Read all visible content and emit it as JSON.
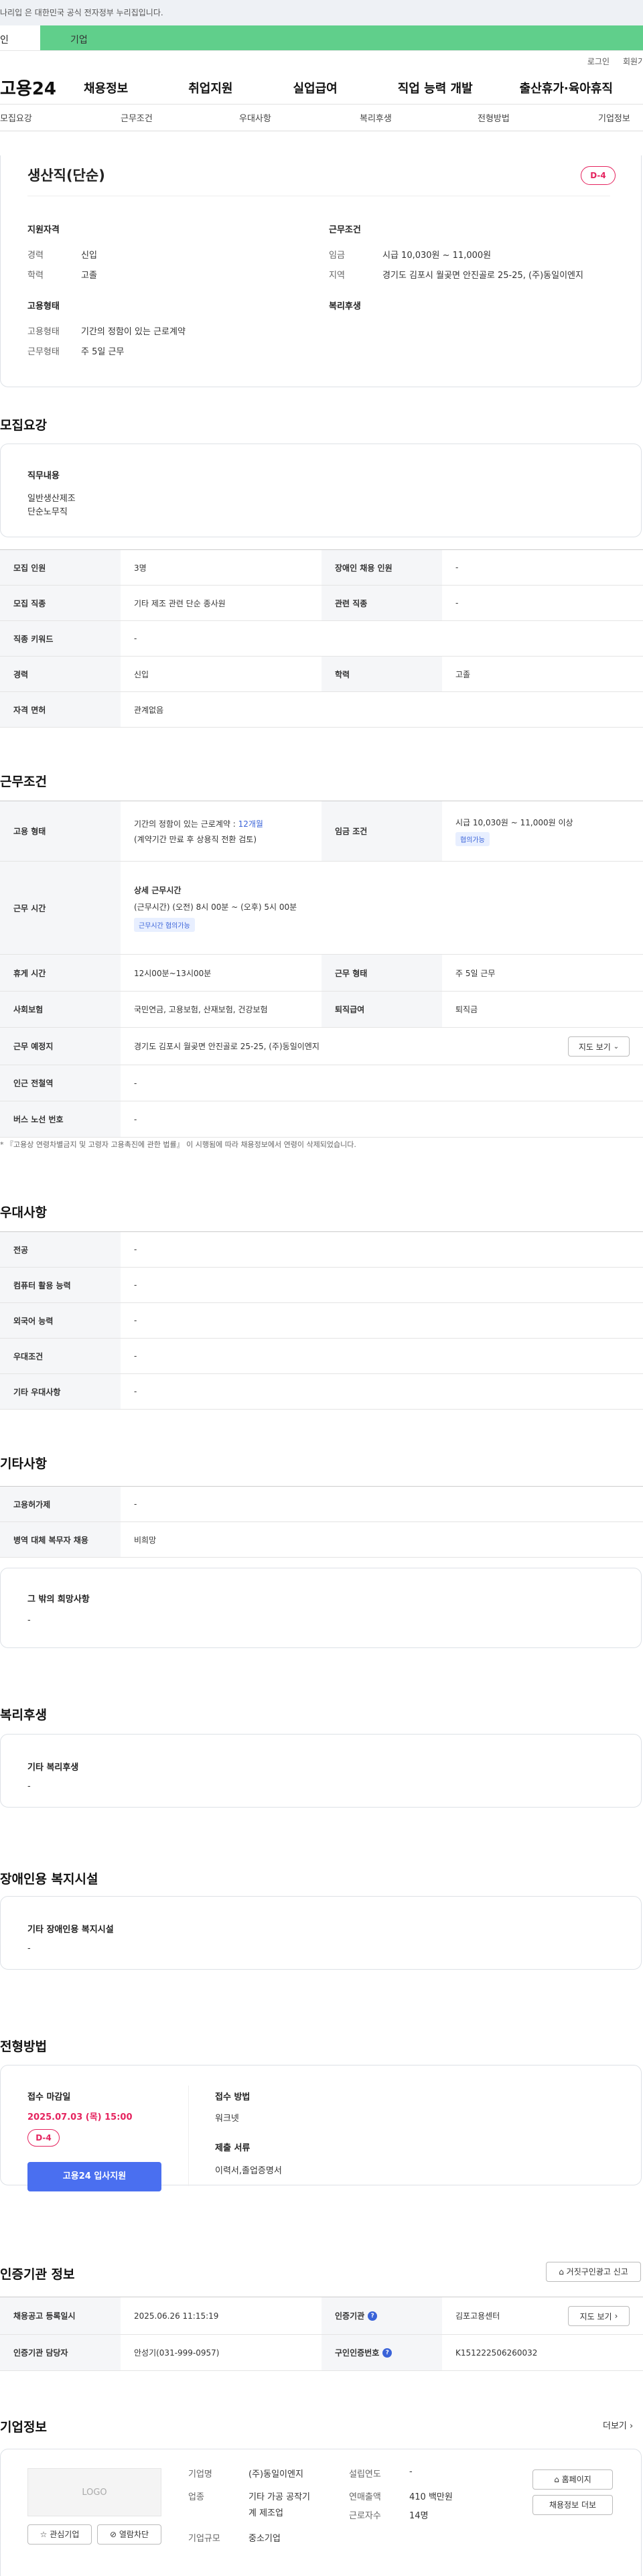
{
  "top": {
    "gov_notice": "나리입 은 대한민국 공식 전자정부 누리집입니다.",
    "sel_individual": "인",
    "sel_company": "기업"
  },
  "util": {
    "login": "로그인",
    "join": "회원가"
  },
  "gnb": {
    "logo": "고용24",
    "menus": [
      "채용정보",
      "취업지원",
      "실업급여",
      "직업 능력 개발",
      "출산휴가·육아휴직"
    ]
  },
  "anchor": [
    "모집요강",
    "근무조건",
    "우대사항",
    "복리후생",
    "전형방법",
    "기업정보"
  ],
  "summary": {
    "title": "생산직(단순)",
    "dday": "D-4",
    "qual_title": "지원자격",
    "cond_title": "근무조건",
    "career_k": "경력",
    "career_v": "신입",
    "edu_k": "학력",
    "edu_v": "고졸",
    "wage_k": "임금",
    "wage_v": "시급 10,030원 ~ 11,000원",
    "loc_k": "지역",
    "loc_v": "경기도 김포시 월곶면 안진골로 25-25, (주)동일이엔지",
    "emp_title": "고용형태",
    "welfare_title": "복리후생",
    "emptype_k": "고용형태",
    "emptype_v": "기간의 정함이 있는 근로계약",
    "worktype_k": "근무형태",
    "worktype_v": "주 5일 근무"
  },
  "recruit": {
    "heading": "모집요강",
    "duty_label": "직무내용",
    "duty_lines": [
      "일반생산제조",
      "단순노무직"
    ],
    "rows": [
      [
        "모집 인원",
        "3명",
        "장애인 채용 인원",
        "-"
      ],
      [
        "모집 직종",
        "기타 제조 관련 단순 종사원",
        "관련 직종",
        "-"
      ],
      [
        "직종 키워드",
        "-"
      ],
      [
        "경력",
        "신입",
        "학력",
        "고졸"
      ],
      [
        "자격 면허",
        "관계없음"
      ]
    ]
  },
  "cond": {
    "heading": "근무조건",
    "emp_th": "고용 형태",
    "emp_v1": "기간의 정함이 있는 근로계약 : ",
    "emp_months": "12개월",
    "emp_v2": "(계약기간 만료 후 상용직 전환 검토)",
    "wage_th": "임금 조건",
    "wage_v": "시급 10,030원 ~ 11,000원 이상",
    "wage_tag": "협의가능",
    "time_th": "근무 시간",
    "time_title": "상세 근무시간",
    "time_v": "(근무시간) (오전) 8시 00분 ~ (오후) 5시 00분",
    "time_tag": "근무시간 협의가능",
    "rest_th": "휴게 시간",
    "rest_v": "12시00분~13시00분",
    "form_th": "근무 형태",
    "form_v": "주 5일 근무",
    "ins_th": "사회보험",
    "ins_v": "국민연금, 고용보험, 산재보험, 건강보험",
    "ret_th": "퇴직급여",
    "ret_v": "퇴직금",
    "place_th": "근무 예정지",
    "place_v": "경기도 김포시 월곶면 안진골로 25-25, (주)동일이엔지",
    "map_btn": "지도 보기",
    "subway_th": "인근 전철역",
    "subway_v": "-",
    "bus_th": "버스 노선 번호",
    "bus_v": "-",
    "note": "* 『고용상 연령차별금지 및 고령자 고용촉진에 관한 법률』 이 시행됨에 따라 채용정보에서 연령이 삭제되었습니다."
  },
  "pref": {
    "heading": "우대사항",
    "rows": [
      [
        "전공",
        "-"
      ],
      [
        "컴퓨터 활용 능력",
        "-"
      ],
      [
        "외국어 능력",
        "-"
      ],
      [
        "우대조건",
        "-"
      ],
      [
        "기타 우대사항",
        "-"
      ]
    ]
  },
  "etc": {
    "heading": "기타사항",
    "rows": [
      [
        "고용허가제",
        "-"
      ],
      [
        "병역 대체 복무자 채용",
        "비희망"
      ]
    ],
    "box_label": "그 밖의 희망사항",
    "box_v": "-"
  },
  "welfare": {
    "heading": "복리후생",
    "box_label": "기타 복리후생",
    "box_v": "-"
  },
  "disab": {
    "heading": "장애인용 복지시설",
    "box_label": "기타 장애인용 복지시설",
    "box_v": "-"
  },
  "proc": {
    "heading": "전형방법",
    "deadline_label": "접수 마감일",
    "deadline_v": "2025.07.03 (목) 15:00",
    "dday": "D-4",
    "apply_btn": "고용24 입사지원",
    "method_label": "접수 방법",
    "method_v": "워크넷",
    "docs_label": "제출 서류",
    "docs_v": "이력서,졸업증명서"
  },
  "agency": {
    "heading": "인증기관 정보",
    "report_btn": "거짓구인광고 신고",
    "reg_th": "채용공고 등록일시",
    "reg_v": "2025.06.26 11:15:19",
    "org_th": "인증기관",
    "org_v": "김포고용센터",
    "map_btn": "지도 보기",
    "mgr_th": "인증기관 담당자",
    "mgr_v": "안성기(031-999-0957)",
    "num_th": "구인인증번호",
    "num_v": "K151222506260032"
  },
  "company": {
    "heading": "기업정보",
    "more": "더보기",
    "logo": "LOGO",
    "fav_btn": "관심기업",
    "block_btn": "열람차단",
    "name_k": "기업명",
    "name_v": "(주)동일이엔지",
    "ind_k": "업종",
    "ind_v1": "기타 가공 공작기",
    "ind_v2": "계 제조업",
    "size_k": "기업규모",
    "size_v": "중소기업",
    "year_k": "설립연도",
    "year_v": "-",
    "sales_k": "연매출액",
    "sales_v": "410 백만원",
    "emp_k": "근로자수",
    "emp_v": "14명",
    "home_btn": "홈페이지",
    "jobs_btn": "채용정보 더보"
  }
}
